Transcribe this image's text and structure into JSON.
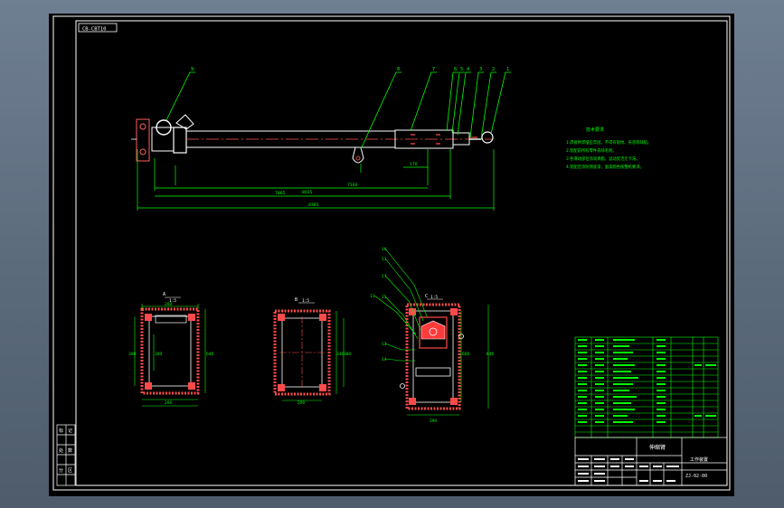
{
  "drawing": {
    "code_box": "CB-CBT10",
    "balloons_top": [
      "9",
      "8",
      "7",
      "6",
      "5",
      "4",
      "3",
      "2",
      "1"
    ],
    "dims_top": [
      "170",
      "7160",
      "7865",
      "8035",
      "8385"
    ],
    "tech_req": {
      "title": "技术要求",
      "lines": [
        "1.焊接件焊缝应牢固，不得有裂纹、夹渣等缺陷。",
        "2.装配前所有零件去除毛刺。",
        "3.各滑动部位涂润滑脂，运动灵活无卡滞。",
        "4.装配后涂防锈底漆，面漆颜色按整机要求。"
      ]
    },
    "sections": [
      {
        "label": "A",
        "scale": "1:5",
        "dims": [
          "200",
          "300",
          "640",
          "300",
          "200"
        ]
      },
      {
        "label": "B",
        "scale": "1:5",
        "dims": [
          "330",
          "380",
          "200"
        ]
      },
      {
        "label": "C",
        "scale": "1:5",
        "dims": [
          "600",
          "640",
          "390"
        ],
        "balloons": [
          "16",
          "11",
          "17",
          "11",
          "15",
          "13",
          "14"
        ]
      }
    ],
    "title_block": {
      "name": "伸缩臂",
      "subtitle": "工作装置",
      "code": "ZJ-02-00"
    },
    "left_block_chars": [
      "标",
      "记",
      "处",
      "数",
      "分",
      "区"
    ]
  }
}
